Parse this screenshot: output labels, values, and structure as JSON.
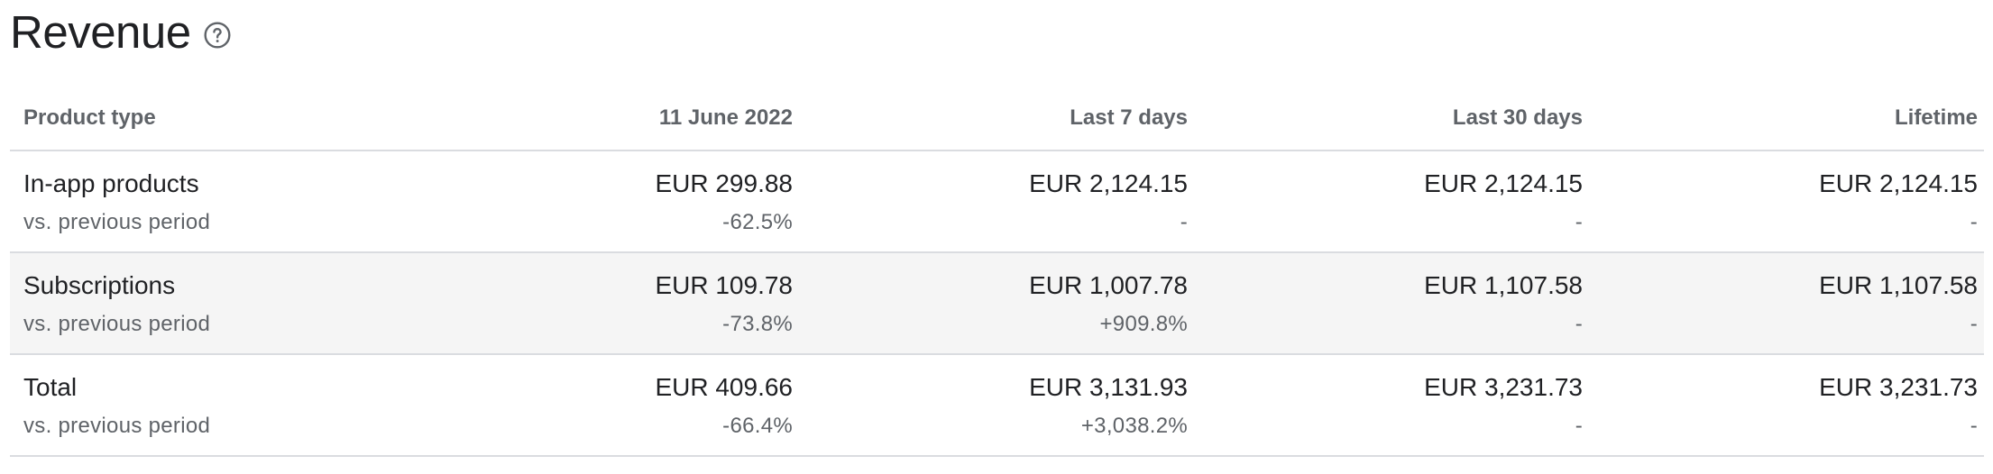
{
  "title": "Revenue",
  "columns": [
    "Product type",
    "11 June 2022",
    "Last 7 days",
    "Last 30 days",
    "Lifetime"
  ],
  "rows": [
    {
      "label": "In-app products",
      "sublabel": "vs. previous period",
      "values": [
        "EUR 299.88",
        "EUR 2,124.15",
        "EUR 2,124.15",
        "EUR 2,124.15"
      ],
      "changes": [
        "-62.5%",
        "-",
        "-",
        "-"
      ]
    },
    {
      "label": "Subscriptions",
      "sublabel": "vs. previous period",
      "values": [
        "EUR 109.78",
        "EUR 1,007.78",
        "EUR 1,107.58",
        "EUR 1,107.58"
      ],
      "changes": [
        "-73.8%",
        "+909.8%",
        "-",
        "-"
      ]
    },
    {
      "label": "Total",
      "sublabel": "vs. previous period",
      "values": [
        "EUR 409.66",
        "EUR 3,131.93",
        "EUR 3,231.73",
        "EUR 3,231.73"
      ],
      "changes": [
        "-66.4%",
        "+3,038.2%",
        "-",
        "-"
      ]
    }
  ]
}
